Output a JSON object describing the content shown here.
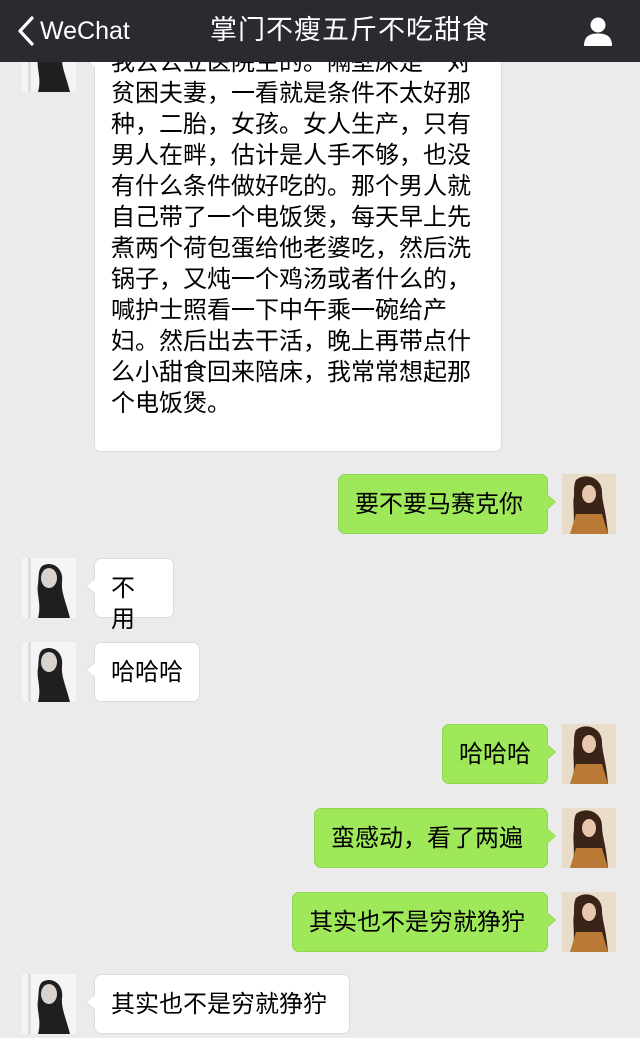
{
  "header": {
    "back_label": "WeChat",
    "title": "掌门不瘦五斤不吃甜食",
    "back_icon": "chevron-left-icon",
    "profile_icon": "user-icon"
  },
  "colors": {
    "header_bg": "#2b2a30",
    "chat_bg": "#ebebeb",
    "incoming_bubble": "#ffffff",
    "outgoing_bubble": "#9ee85a"
  },
  "messages": [
    {
      "side": "left",
      "text": "我去公立医院生的。隔壁床是一对\n贫困夫妻，一看就是条件不太好那\n种，二胎，女孩。女人生产，只有\n男人在畔，估计是人手不够，也没\n有什么条件做好吃的。那个男人就\n自己带了一个电饭煲，每天早上先\n煮两个荷包蛋给他老婆吃，然后洗\n锅子，又炖一个鸡汤或者什么的，\n喊护士照看一下中午乘一碗给产\n妇。然后出去干活，晚上再带点什\n么小甜食回来陪床，我常常想起那\n个电饭煲。"
    },
    {
      "side": "right",
      "text": "要不要马赛克你"
    },
    {
      "side": "left",
      "text": "不用"
    },
    {
      "side": "left",
      "text": "哈哈哈"
    },
    {
      "side": "right",
      "text": "哈哈哈"
    },
    {
      "side": "right",
      "text": "蛮感动，看了两遍"
    },
    {
      "side": "right",
      "text": "其实也不是穷就狰狞"
    },
    {
      "side": "left",
      "text": "其实也不是穷就狰狞"
    }
  ]
}
